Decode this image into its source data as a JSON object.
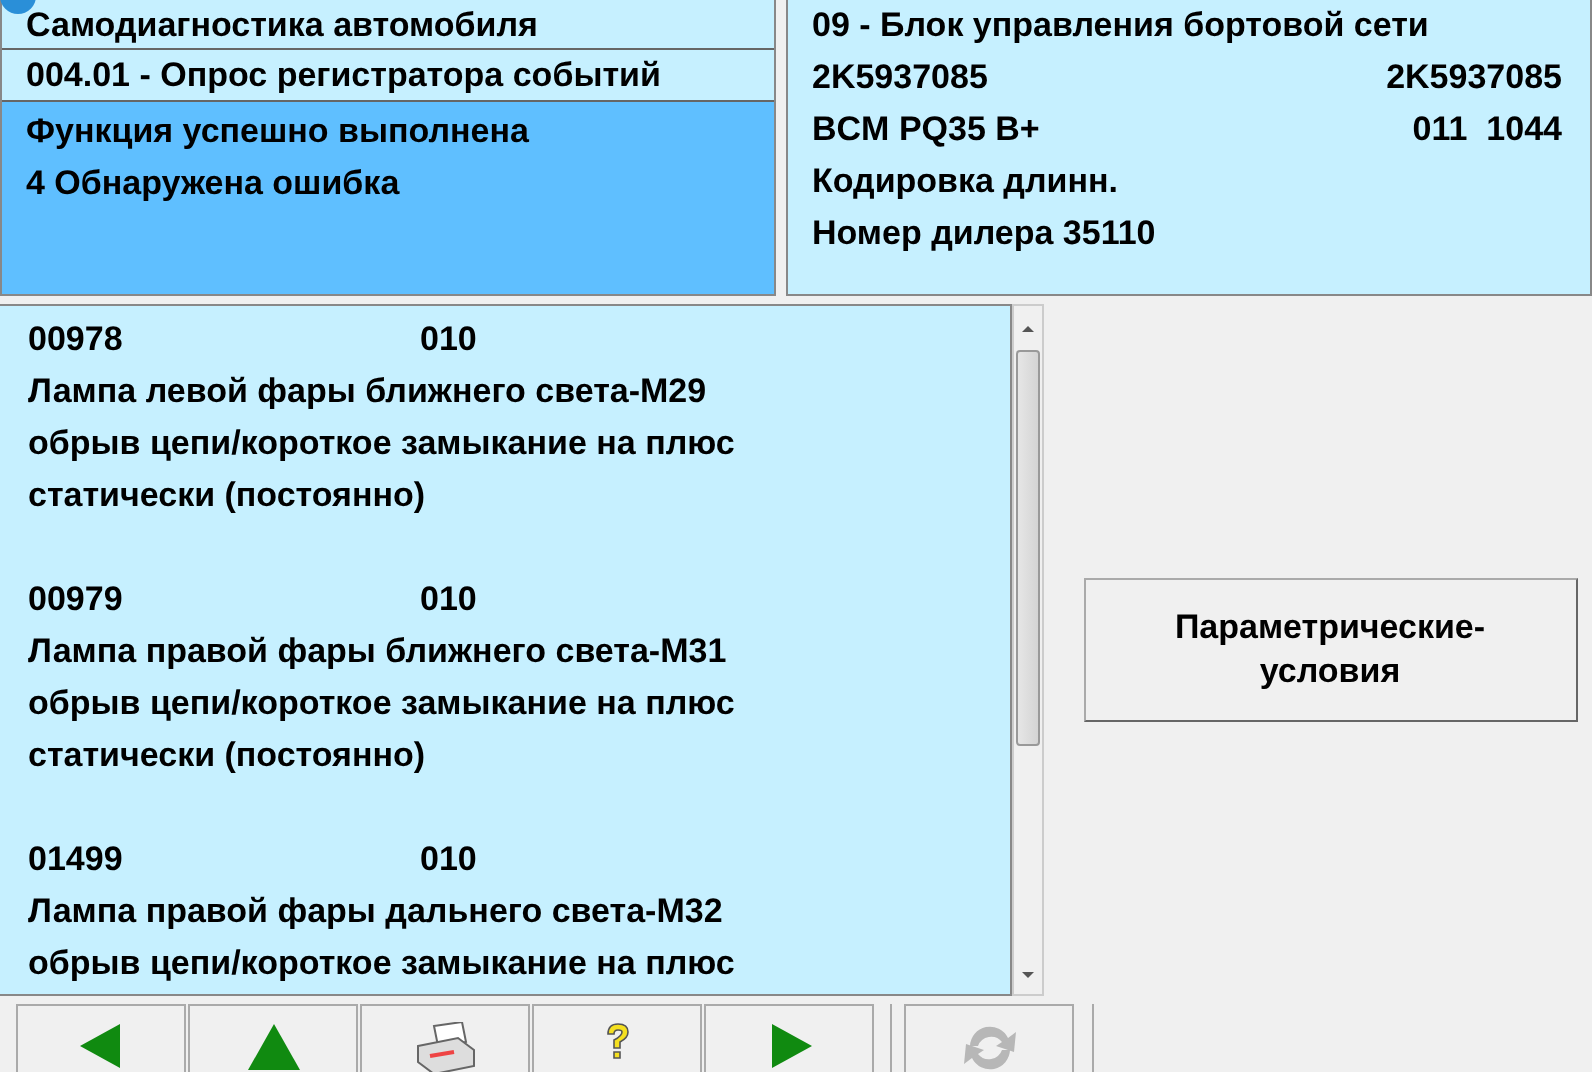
{
  "header": {
    "title": "Самодиагностика автомобиля",
    "function": "004.01 - Опрос регистратора событий",
    "status_lines": [
      "Функция успешно выполнена",
      "4 Обнаружена ошибка"
    ]
  },
  "module": {
    "rows": [
      {
        "left": "09 - Блок управления бортовой сети"
      },
      {
        "left": "2K5937085",
        "right": "2K5937085"
      },
      {
        "left": "BCM PQ35 B+",
        "right": "011  1044"
      },
      {
        "left": "Кодировка длинн."
      },
      {
        "left": "Номер дилера 35110"
      }
    ]
  },
  "faults": [
    {
      "code": "00978",
      "status": "010",
      "lines": [
        "Лампа левой фары ближнего света-M29",
        "обрыв цепи/короткое замыкание на плюс",
        "статически (постоянно)"
      ]
    },
    {
      "code": "00979",
      "status": "010",
      "lines": [
        "Лампа правой фары ближнего света-M31",
        "обрыв цепи/короткое замыкание на плюс",
        "статически (постоянно)"
      ]
    },
    {
      "code": "01499",
      "status": "010",
      "lines": [
        "Лампа правой фары дальнего света-M32",
        "обрыв цепи/короткое замыкание на плюс"
      ]
    }
  ],
  "side_button": "Параметрические-условия",
  "toolbar": [
    {
      "kind": "back",
      "disabled": false
    },
    {
      "kind": "up",
      "disabled": false
    },
    {
      "kind": "print",
      "disabled": false
    },
    {
      "kind": "help",
      "disabled": false
    },
    {
      "kind": "forward",
      "disabled": false
    },
    {
      "kind": "refresh",
      "disabled": true
    }
  ]
}
